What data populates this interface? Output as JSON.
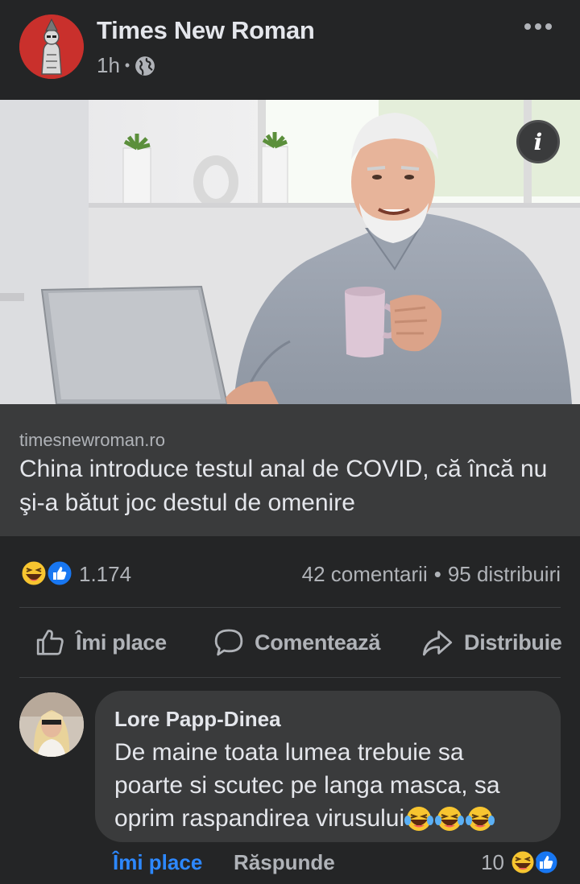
{
  "post": {
    "page_name": "Times New Roman",
    "time": "1h",
    "separator": "•",
    "privacy_icon": "globe-icon",
    "more_icon": "more-horizontal-icon"
  },
  "link_preview": {
    "domain": "timesnewroman.ro",
    "title": "China introduce testul anal de COVID, că încă nu şi-a bătut joc destul de omenire",
    "info_label": "i"
  },
  "stats": {
    "reaction_icons": [
      "haha-icon",
      "like-icon"
    ],
    "reaction_count": "1.174",
    "comments": "42 comentarii",
    "separator": "•",
    "shares": "95 distribuiri"
  },
  "actions": {
    "like": "Îmi place",
    "comment": "Comentează",
    "share": "Distribuie"
  },
  "comment": {
    "author": "Lore Papp-Dinea",
    "text_line1": "De maine toata lumea trebuie sa",
    "text_line2": "poarte si scutec pe langa masca, sa",
    "text_line3": "oprim raspandirea virusului",
    "like_label": "Îmi place",
    "reply_label": "Răspunde",
    "reaction_count": "10",
    "reaction_icons": [
      "haha-icon",
      "like-icon"
    ]
  },
  "colors": {
    "background": "#242526",
    "card": "#3a3b3c",
    "text_primary": "#e4e6eb",
    "text_secondary": "#b0b3b8",
    "link_blue": "#2d88ff",
    "brand_red": "#c9302c"
  }
}
